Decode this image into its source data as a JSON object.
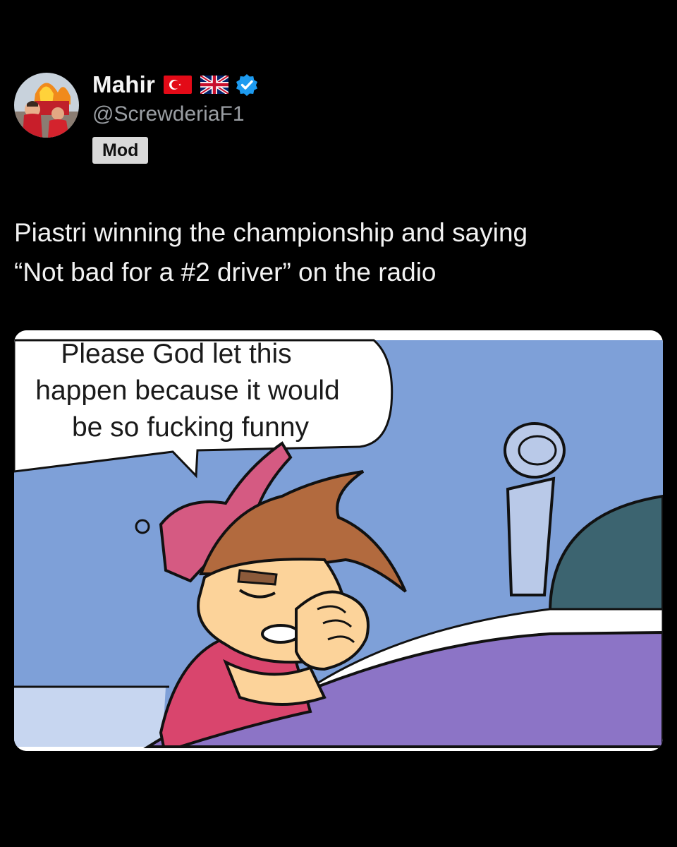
{
  "author": {
    "display_name": "Mahir",
    "handle": "@ScrewderiaF1",
    "badge": "Mod",
    "flags": [
      "turkey-flag-icon",
      "uk-flag-icon"
    ],
    "verified_icon": "verified-badge-icon",
    "verified_color": "#1d9bf0"
  },
  "tweet": {
    "text": "Piastri winning the championship and saying\n“Not bad for a #2 driver” on the radio"
  },
  "media": {
    "speech_lines": [
      "Please God let this",
      "happen because it would",
      "be so fucking funny"
    ]
  },
  "colors": {
    "background": "#000000",
    "handle": "#9a9ea3",
    "badge_bg": "#d9d9d9"
  }
}
